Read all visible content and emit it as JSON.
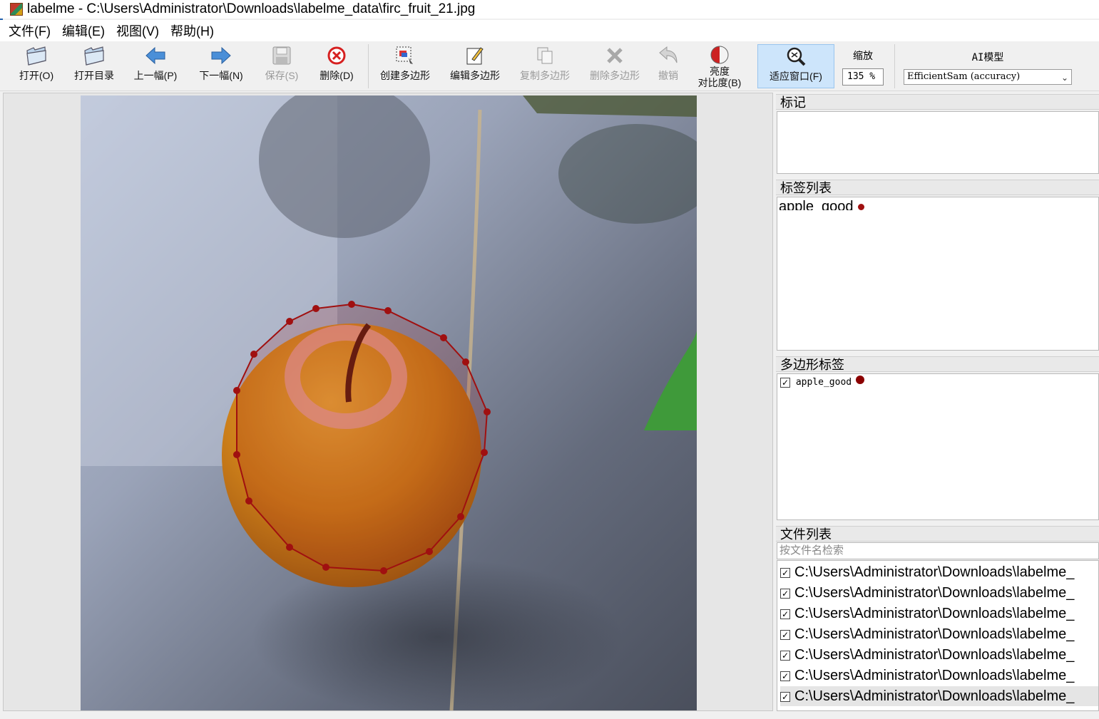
{
  "window": {
    "title": "labelme - C:\\Users\\Administrator\\Downloads\\labelme_data\\firc_fruit_21.jpg"
  },
  "menu": [
    "文件(F)",
    "编辑(E)",
    "视图(V)",
    "帮助(H)"
  ],
  "toolbar": {
    "open": "打开(O)",
    "open_dir": "打开目录",
    "prev": "上一幅(P)",
    "next": "下一幅(N)",
    "save": "保存(S)",
    "delete": "删除(D)",
    "create_polygon": "创建多边形",
    "edit_polygon": "编辑多边形",
    "copy_polygon": "复制多边形",
    "delete_polygon": "删除多边形",
    "undo": "撤销",
    "brightness_line1": "亮度",
    "brightness_line2": "对比度(B)",
    "fit_window": "适应窗口(F)",
    "zoom_label": "缩放",
    "zoom_value": "135 %",
    "ai_label": "AI模型",
    "ai_model": "EfficientSam (accuracy)"
  },
  "panels": {
    "flags_title": "标记",
    "label_list_title": "标签列表",
    "label_list_items": [
      {
        "text": "apple_good",
        "color": "#8b0000"
      }
    ],
    "polygon_labels_title": "多边形标签",
    "polygon_labels": [
      {
        "text": "apple_good",
        "checked": true,
        "color": "#8b0000"
      }
    ],
    "file_list_title": "文件列表",
    "file_search_placeholder": "按文件名检索",
    "files": [
      "C:\\Users\\Administrator\\Downloads\\labelme_",
      "C:\\Users\\Administrator\\Downloads\\labelme_",
      "C:\\Users\\Administrator\\Downloads\\labelme_",
      "C:\\Users\\Administrator\\Downloads\\labelme_",
      "C:\\Users\\Administrator\\Downloads\\labelme_",
      "C:\\Users\\Administrator\\Downloads\\labelme_",
      "C:\\Users\\Administrator\\Downloads\\labelme_"
    ]
  },
  "annotation": {
    "label": "apple_good",
    "color": "#a01010"
  },
  "icons": {
    "open": "folder-open-icon",
    "open_dir": "folder-icon",
    "prev": "arrow-left-icon",
    "next": "arrow-right-icon",
    "save": "save-icon",
    "delete": "delete-circle-icon",
    "create_polygon": "create-polygon-icon",
    "edit_polygon": "edit-icon",
    "copy_polygon": "copy-icon",
    "delete_polygon": "x-icon",
    "undo": "undo-icon",
    "brightness": "brightness-icon",
    "fit_window": "zoom-fit-icon"
  }
}
